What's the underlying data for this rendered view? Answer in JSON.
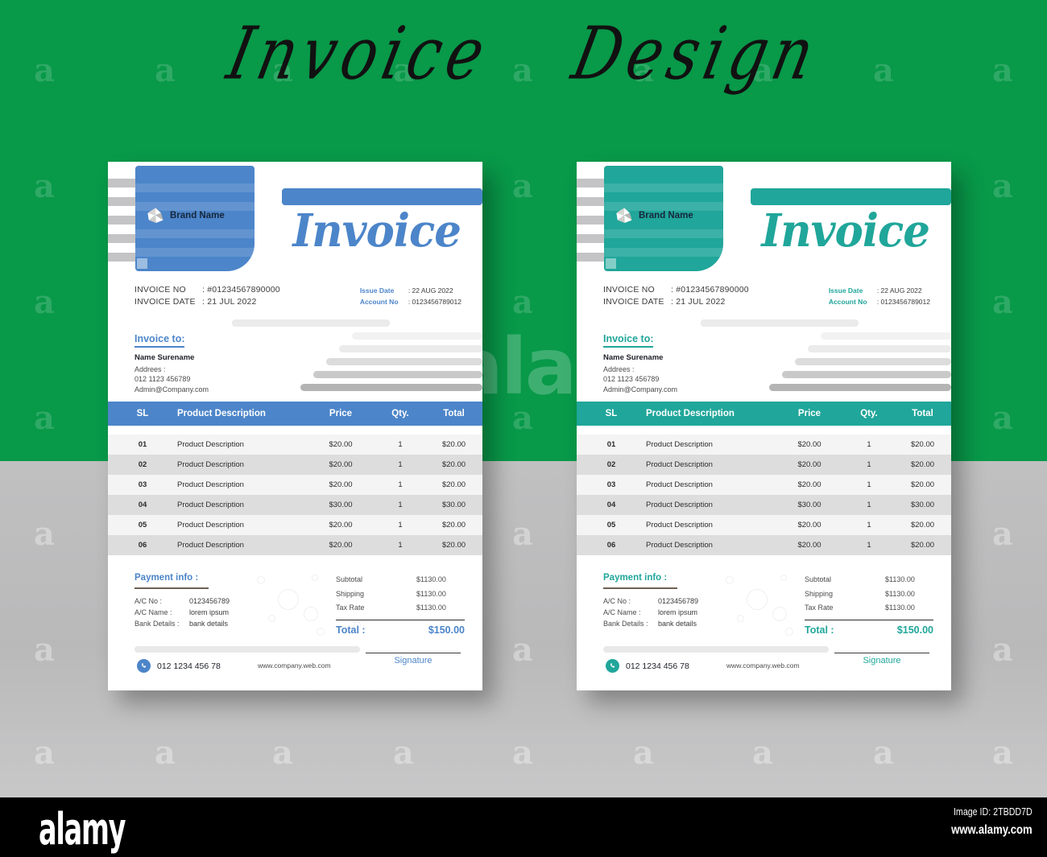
{
  "poster": {
    "title_word_1": "Invoice",
    "title_word_2": "Design",
    "bg_green": "#089949",
    "bg_gray": "#bcbcbd",
    "watermark_letter": "a",
    "watermark_brand": "alamy"
  },
  "footer_bar": {
    "logo": "alamy",
    "image_id": "Image ID: 2TBDD7D",
    "url": "www.alamy.com"
  },
  "invoices": [
    {
      "variant": "blue",
      "accent": "#4c85c9",
      "accent_dark": "#3a74bd",
      "brand": {
        "name": "Brand Name",
        "logo_icon": "pinwheel-logo-icon"
      },
      "title": "Invoice",
      "meta_left": [
        {
          "label": "INVOICE NO",
          "value": ": #01234567890000"
        },
        {
          "label": "INVOICE DATE",
          "value": ": 21 JUL  2022"
        }
      ],
      "meta_right": [
        {
          "label": "Issue Date",
          "value": ": 22 AUG 2022"
        },
        {
          "label": "Account No",
          "value": ": 0123456789012"
        }
      ],
      "invoice_to": {
        "heading": "Invoice to:",
        "name": "Name Surename",
        "address_label": "Addrees :",
        "phone": "012 1123 456789",
        "email": "Admin@Company.com"
      },
      "table": {
        "headers": [
          "SL",
          "Product Description",
          "Price",
          "Qty.",
          "Total"
        ],
        "rows": [
          [
            "01",
            "Product Description",
            "$20.00",
            "1",
            "$20.00"
          ],
          [
            "02",
            "Product Description",
            "$20.00",
            "1",
            "$20.00"
          ],
          [
            "03",
            "Product Description",
            "$20.00",
            "1",
            "$20.00"
          ],
          [
            "04",
            "Product Description",
            "$30.00",
            "1",
            "$30.00"
          ],
          [
            "05",
            "Product Description",
            "$20.00",
            "1",
            "$20.00"
          ],
          [
            "06",
            "Product Description",
            "$20.00",
            "1",
            "$20.00"
          ]
        ]
      },
      "payment": {
        "heading": "Payment info :",
        "rows": [
          {
            "key": "A/C No :",
            "value": "0123456789"
          },
          {
            "key": "A/C Name :",
            "value": "lorem ipsum"
          },
          {
            "key": "Bank Details :",
            "value": "bank details"
          }
        ]
      },
      "totals": {
        "rows": [
          {
            "label": "Subtotal",
            "value": "$1130.00"
          },
          {
            "label": "Shipping",
            "value": "$1130.00"
          },
          {
            "label": "Tax Rate",
            "value": "$1130.00"
          }
        ],
        "grand_label": "Total :",
        "grand_value": "$150.00"
      },
      "footer": {
        "phone_icon": "phone-icon",
        "phone": "012 1234 456 78",
        "website": "www.company.web.com",
        "signature": "Signature"
      }
    },
    {
      "variant": "teal",
      "accent": "#20a69a",
      "accent_dark": "#179b90",
      "brand": {
        "name": "Brand Name",
        "logo_icon": "pinwheel-logo-icon"
      },
      "title": "Invoice",
      "meta_left": [
        {
          "label": "INVOICE NO",
          "value": ": #01234567890000"
        },
        {
          "label": "INVOICE DATE",
          "value": ": 21 JUL  2022"
        }
      ],
      "meta_right": [
        {
          "label": "Issue Date",
          "value": ": 22 AUG 2022"
        },
        {
          "label": "Account No",
          "value": ": 0123456789012"
        }
      ],
      "invoice_to": {
        "heading": "Invoice to:",
        "name": "Name Surename",
        "address_label": "Addrees :",
        "phone": "012 1123 456789",
        "email": "Admin@Company.com"
      },
      "table": {
        "headers": [
          "SL",
          "Product Description",
          "Price",
          "Qty.",
          "Total"
        ],
        "rows": [
          [
            "01",
            "Product Description",
            "$20.00",
            "1",
            "$20.00"
          ],
          [
            "02",
            "Product Description",
            "$20.00",
            "1",
            "$20.00"
          ],
          [
            "03",
            "Product Description",
            "$20.00",
            "1",
            "$20.00"
          ],
          [
            "04",
            "Product Description",
            "$30.00",
            "1",
            "$30.00"
          ],
          [
            "05",
            "Product Description",
            "$20.00",
            "1",
            "$20.00"
          ],
          [
            "06",
            "Product Description",
            "$20.00",
            "1",
            "$20.00"
          ]
        ]
      },
      "payment": {
        "heading": "Payment info :",
        "rows": [
          {
            "key": "A/C No :",
            "value": "0123456789"
          },
          {
            "key": "A/C Name :",
            "value": "lorem ipsum"
          },
          {
            "key": "Bank Details :",
            "value": "bank details"
          }
        ]
      },
      "totals": {
        "rows": [
          {
            "label": "Subtotal",
            "value": "$1130.00"
          },
          {
            "label": "Shipping",
            "value": "$1130.00"
          },
          {
            "label": "Tax Rate",
            "value": "$1130.00"
          }
        ],
        "grand_label": "Total :",
        "grand_value": "$150.00"
      },
      "footer": {
        "phone_icon": "phone-icon",
        "phone": "012 1234 456 78",
        "website": "www.company.web.com",
        "signature": "Signature"
      }
    }
  ]
}
